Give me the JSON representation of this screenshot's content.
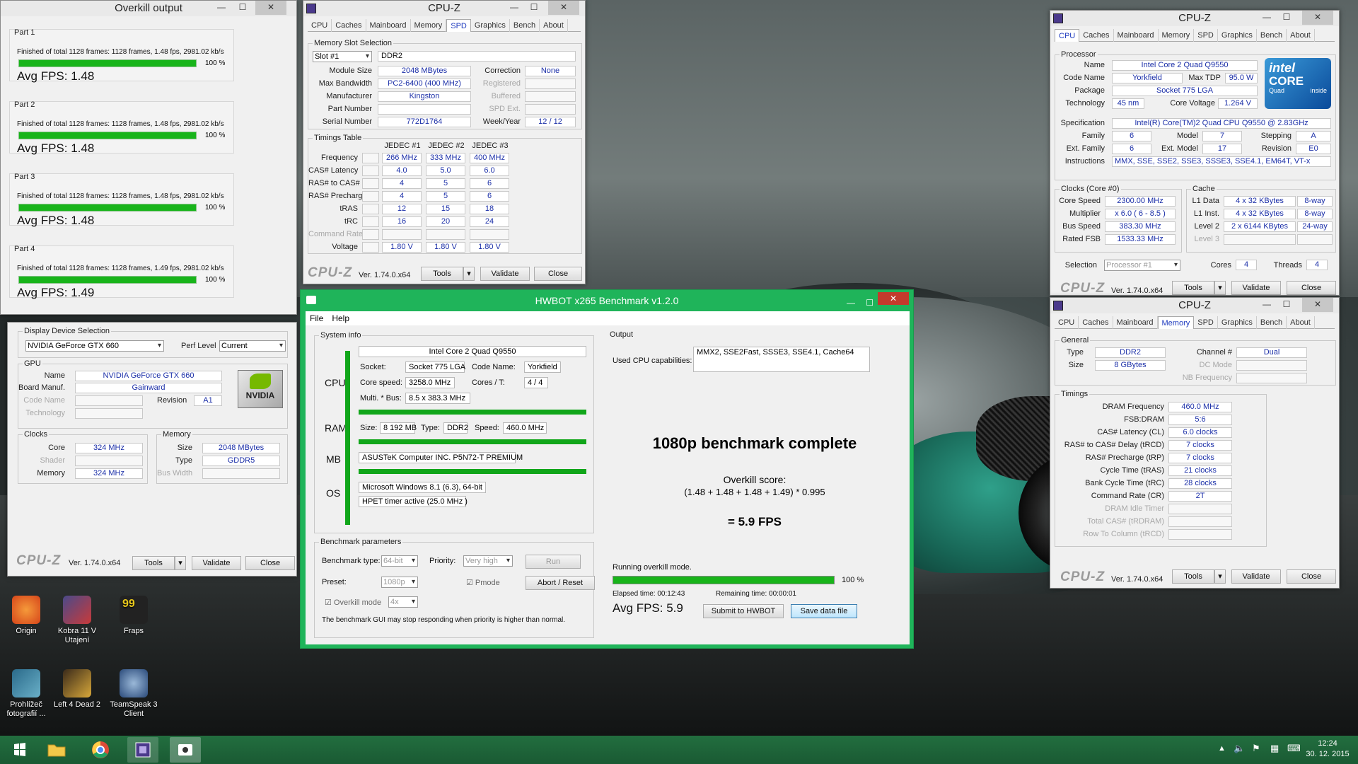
{
  "overkill": {
    "title": "Overkill output",
    "parts": [
      {
        "label": "Part 1",
        "line": "Finished of total 1128 frames: 1128 frames, 1.48 fps, 2981.02 kb/s",
        "pct": "100 %",
        "progress": 1.0,
        "avg": "Avg FPS: 1.48"
      },
      {
        "label": "Part 2",
        "line": "Finished of total 1128 frames: 1128 frames, 1.48 fps, 2981.02 kb/s",
        "pct": "100 %",
        "progress": 1.0,
        "avg": "Avg FPS: 1.48"
      },
      {
        "label": "Part 3",
        "line": "Finished of total 1128 frames: 1128 frames, 1.48 fps, 2981.02 kb/s",
        "pct": "100 %",
        "progress": 1.0,
        "avg": "Avg FPS: 1.48"
      },
      {
        "label": "Part 4",
        "line": "Finished of total 1128 frames: 1128 frames, 1.49 fps, 2981.02 kb/s",
        "pct": "100 %",
        "progress": 1.0,
        "avg": "Avg FPS: 1.49"
      }
    ]
  },
  "cpuz_spd": {
    "title": "CPU-Z",
    "tabs": [
      "CPU",
      "Caches",
      "Mainboard",
      "Memory",
      "SPD",
      "Graphics",
      "Bench",
      "About"
    ],
    "active_tab": "SPD",
    "slot_group": "Memory Slot Selection",
    "slot": "Slot #1",
    "slot_type": "DDR2",
    "module_size_l": "Module Size",
    "module_size": "2048 MBytes",
    "correction_l": "Correction",
    "correction": "None",
    "max_bw_l": "Max Bandwidth",
    "max_bw": "PC2-6400 (400 MHz)",
    "registered_l": "Registered",
    "manufacturer_l": "Manufacturer",
    "manufacturer": "Kingston",
    "buffered_l": "Buffered",
    "part_l": "Part Number",
    "spd_ext_l": "SPD Ext.",
    "serial_l": "Serial Number",
    "serial": "772D1764",
    "week_l": "Week/Year",
    "week": "12 / 12",
    "timings_group": "Timings Table",
    "cols": [
      "JEDEC #1",
      "JEDEC #2",
      "JEDEC #3"
    ],
    "rows": [
      {
        "label": "Frequency",
        "v": [
          "266 MHz",
          "333 MHz",
          "400 MHz"
        ]
      },
      {
        "label": "CAS# Latency",
        "v": [
          "4.0",
          "5.0",
          "6.0"
        ]
      },
      {
        "label": "RAS# to CAS#",
        "v": [
          "4",
          "5",
          "6"
        ]
      },
      {
        "label": "RAS# Precharge",
        "v": [
          "4",
          "5",
          "6"
        ]
      },
      {
        "label": "tRAS",
        "v": [
          "12",
          "15",
          "18"
        ]
      },
      {
        "label": "tRC",
        "v": [
          "16",
          "20",
          "24"
        ]
      },
      {
        "label": "Command Rate",
        "v": [
          "",
          "",
          ""
        ]
      },
      {
        "label": "Voltage",
        "v": [
          "1.80 V",
          "1.80 V",
          "1.80 V"
        ]
      }
    ],
    "logo": "CPU-Z",
    "version": "Ver. 1.74.0.x64",
    "tools": "Tools",
    "validate": "Validate",
    "close": "Close"
  },
  "cpuz_gpu": {
    "display_group": "Display Device Selection",
    "device": "NVIDIA GeForce GTX 660",
    "perf_l": "Perf Level",
    "perf": "Current",
    "gpu_group": "GPU",
    "name_l": "Name",
    "name": "NVIDIA GeForce GTX 660",
    "board_l": "Board Manuf.",
    "board": "Gainward",
    "code_l": "Code Name",
    "revision_l": "Revision",
    "revision": "A1",
    "tech_l": "Technology",
    "nvidia": "NVIDIA",
    "clocks_group": "Clocks",
    "core_l": "Core",
    "core": "324 MHz",
    "shader_l": "Shader",
    "memory_l": "Memory",
    "memory": "324 MHz",
    "mem_group": "Memory",
    "size_l": "Size",
    "size": "2048 MBytes",
    "type_l": "Type",
    "type": "GDDR5",
    "bus_l": "Bus Width",
    "logo": "CPU-Z",
    "version": "Ver. 1.74.0.x64",
    "tools": "Tools",
    "validate": "Validate",
    "close": "Close"
  },
  "cpuz_cpu": {
    "title": "CPU-Z",
    "tabs": [
      "CPU",
      "Caches",
      "Mainboard",
      "Memory",
      "SPD",
      "Graphics",
      "Bench",
      "About"
    ],
    "active_tab": "CPU",
    "proc_group": "Processor",
    "name_l": "Name",
    "name": "Intel Core 2 Quad Q9550",
    "code_l": "Code Name",
    "code": "Yorkfield",
    "tdp_l": "Max TDP",
    "tdp": "95.0 W",
    "package_l": "Package",
    "package": "Socket 775 LGA",
    "tech_l": "Technology",
    "tech": "45 nm",
    "voltage_l": "Core Voltage",
    "voltage": "1.264 V",
    "spec_l": "Specification",
    "spec": "Intel(R) Core(TM)2 Quad CPU   Q9550  @ 2.83GHz",
    "family_l": "Family",
    "family": "6",
    "model_l": "Model",
    "model": "7",
    "stepping_l": "Stepping",
    "stepping": "A",
    "extfam_l": "Ext. Family",
    "extfam": "6",
    "extmodel_l": "Ext. Model",
    "extmodel": "17",
    "revision_l": "Revision",
    "revision": "E0",
    "instr_l": "Instructions",
    "instr": "MMX, SSE, SSE2, SSE3, SSSE3, SSE4.1, EM64T, VT-x",
    "intel_line1": "intel",
    "intel_line2": "CORE",
    "intel_line3": "Quad",
    "intel_line4": "inside",
    "clocks_group": "Clocks (Core #0)",
    "speed_l": "Core Speed",
    "speed": "2300.00 MHz",
    "mult_l": "Multiplier",
    "mult": "x 6.0 ( 6 - 8.5 )",
    "bus_l": "Bus Speed",
    "bus": "383.30 MHz",
    "fsb_l": "Rated FSB",
    "fsb": "1533.33 MHz",
    "cache_group": "Cache",
    "l1d_l": "L1 Data",
    "l1d": "4 x 32 KBytes",
    "l1d_w": "8-way",
    "l1i_l": "L1 Inst.",
    "l1i": "4 x 32 KBytes",
    "l1i_w": "8-way",
    "l2_l": "Level 2",
    "l2": "2 x 6144 KBytes",
    "l2_w": "24-way",
    "l3_l": "Level 3",
    "sel_l": "Selection",
    "sel": "Processor #1",
    "cores_l": "Cores",
    "cores": "4",
    "threads_l": "Threads",
    "threads": "4",
    "logo": "CPU-Z",
    "version": "Ver. 1.74.0.x64",
    "tools": "Tools",
    "validate": "Validate",
    "close": "Close"
  },
  "cpuz_mem": {
    "title": "CPU-Z",
    "tabs": [
      "CPU",
      "Caches",
      "Mainboard",
      "Memory",
      "SPD",
      "Graphics",
      "Bench",
      "About"
    ],
    "active_tab": "Memory",
    "gen_group": "General",
    "type_l": "Type",
    "type": "DDR2",
    "channel_l": "Channel #",
    "channel": "Dual",
    "size_l": "Size",
    "size": "8 GBytes",
    "dc_l": "DC Mode",
    "nb_l": "NB Frequency",
    "tim_group": "Timings",
    "rows": [
      {
        "label": "DRAM Frequency",
        "v": "460.0 MHz",
        "dim": false
      },
      {
        "label": "FSB:DRAM",
        "v": "5:6",
        "dim": false
      },
      {
        "label": "CAS# Latency (CL)",
        "v": "6.0 clocks",
        "dim": false
      },
      {
        "label": "RAS# to CAS# Delay (tRCD)",
        "v": "7 clocks",
        "dim": false
      },
      {
        "label": "RAS# Precharge (tRP)",
        "v": "7 clocks",
        "dim": false
      },
      {
        "label": "Cycle Time (tRAS)",
        "v": "21 clocks",
        "dim": false
      },
      {
        "label": "Bank Cycle Time (tRC)",
        "v": "28 clocks",
        "dim": false
      },
      {
        "label": "Command Rate (CR)",
        "v": "2T",
        "dim": false
      },
      {
        "label": "DRAM Idle Timer",
        "v": "",
        "dim": true
      },
      {
        "label": "Total CAS# (tRDRAM)",
        "v": "",
        "dim": true
      },
      {
        "label": "Row To Column (tRCD)",
        "v": "",
        "dim": true
      }
    ],
    "logo": "CPU-Z",
    "version": "Ver. 1.74.0.x64",
    "tools": "Tools",
    "validate": "Validate",
    "close": "Close"
  },
  "hwbot": {
    "title": "HWBOT x265 Benchmark v1.2.0",
    "menu": [
      "File",
      "Help"
    ],
    "sysinfo": "System info",
    "cpu_name": "Intel Core 2 Quad Q9550",
    "cpu_l": "CPU",
    "socket_l": "Socket:",
    "socket": "Socket 775 LGA",
    "codename_l": "Code Name:",
    "codename": "Yorkfield",
    "corespeed_l": "Core speed:",
    "corespeed": "3258.0 MHz",
    "cores_l": "Cores / T:",
    "cores": "4 / 4",
    "multi_l": "Multi. * Bus:",
    "multi": "8.5 x 383.3 MHz",
    "ram_l": "RAM",
    "size_l": "Size:",
    "size": "8 192 MB",
    "type_l": "Type:",
    "type": "DDR2",
    "speed_l": "Speed:",
    "speed": "460.0 MHz",
    "mb_l": "MB",
    "mb": "ASUSTeK Computer INC. P5N72-T PREMIUM",
    "os_l": "OS",
    "os": "Microsoft Windows 8.1 (6.3), 64-bit",
    "timer": "HPET timer active (25.0 MHz )",
    "params": "Benchmark parameters",
    "btype_l": "Benchmark type:",
    "btype": "64-bit",
    "prio_l": "Priority:",
    "prio": "Very high",
    "run": "Run",
    "preset_l": "Preset:",
    "preset": "1080p",
    "pmode": "Pmode",
    "abort": "Abort / Reset",
    "overkill_l": "Overkill mode",
    "overkill": "4x",
    "warning": "The benchmark GUI may stop responding when priority is higher than normal.",
    "output": "Output",
    "caps_l": "Used CPU capabilities:",
    "caps": "MMX2, SSE2Fast, SSSE3, SSE4.1, Cache64",
    "complete": "1080p benchmark complete",
    "score_l": "Overkill score:",
    "formula": "(1.48 + 1.48 + 1.48 + 1.49) * 0.995",
    "result": "= 5.9 FPS",
    "running": "Running overkill mode.",
    "progress": 1.0,
    "pct": "100 %",
    "elapsed": "Elapsed time: 00:12:43",
    "remaining": "Remaining time: 00:00:01",
    "avg": "Avg FPS: 5.9",
    "submit": "Submit to HWBOT",
    "save": "Save data file"
  },
  "desktop": {
    "icons": [
      {
        "label": "Origin",
        "color": "#e8521c"
      },
      {
        "label": "Kobra 11 V\nUtajení",
        "color": "#c83a3a"
      },
      {
        "label": "Fraps",
        "color": "#e8c81c"
      },
      {
        "label": "Prohlížeč\nfotografií ...",
        "color": "#3a7a9a"
      },
      {
        "label": "Left 4 Dead 2",
        "color": "#b89a2a"
      },
      {
        "label": "TeamSpeak 3\nClient",
        "color": "#3a6aa8"
      }
    ]
  },
  "taskbar": {
    "time": "12:24",
    "date": "30. 12. 2015"
  },
  "colors": {
    "cpuz_value": "#1b2fa8",
    "hwbot_green": "#1fb45a",
    "bar_green": "#18b41a"
  }
}
